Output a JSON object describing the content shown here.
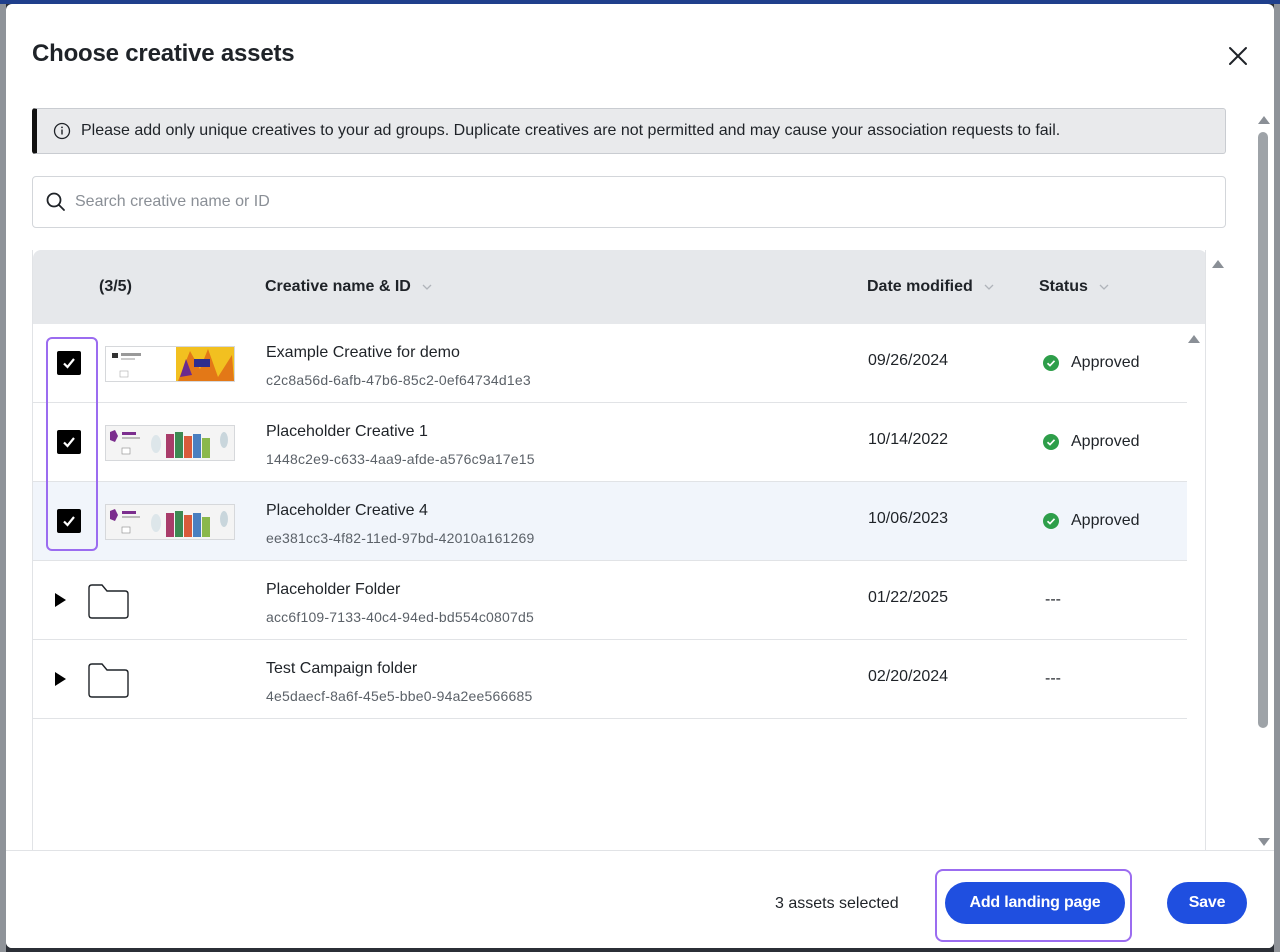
{
  "modal": {
    "title": "Choose creative assets"
  },
  "notice": {
    "text": "Please add only unique creatives to your ad groups. Duplicate creatives are not permitted and may cause your association requests to fail."
  },
  "search": {
    "placeholder": "Search creative name or ID",
    "value": ""
  },
  "table": {
    "columns": {
      "count": "(3/5)",
      "name": "Creative name & ID",
      "date": "Date modified",
      "status": "Status"
    },
    "rows": [
      {
        "type": "creative",
        "checked": true,
        "name": "Example Creative for demo",
        "id": "c2c8a56d-6afb-47b6-85c2-0ef64734d1e3",
        "date": "09/26/2024",
        "status": "Approved"
      },
      {
        "type": "creative",
        "checked": true,
        "name": "Placeholder Creative 1",
        "id": "1448c2e9-c633-4aa9-afde-a576c9a17e15",
        "date": "10/14/2022",
        "status": "Approved"
      },
      {
        "type": "creative",
        "checked": true,
        "name": "Placeholder Creative 4",
        "id": "ee381cc3-4f82-11ed-97bd-42010a161269",
        "date": "10/06/2023",
        "status": "Approved"
      },
      {
        "type": "folder",
        "name": "Placeholder Folder",
        "id": "acc6f109-7133-40c4-94ed-bd554c0807d5",
        "date": "01/22/2025",
        "status": "---"
      },
      {
        "type": "folder",
        "name": "Test Campaign folder",
        "id": "4e5daecf-8a6f-45e5-bbe0-94a2ee566685",
        "date": "02/20/2024",
        "status": "---"
      }
    ]
  },
  "footer": {
    "selected_text": "3 assets selected",
    "add_landing_label": "Add landing page",
    "save_label": "Save"
  },
  "colors": {
    "primary": "#1f4fe0",
    "approved": "#2e9e4a",
    "highlight_outline": "#9b6cf0"
  }
}
